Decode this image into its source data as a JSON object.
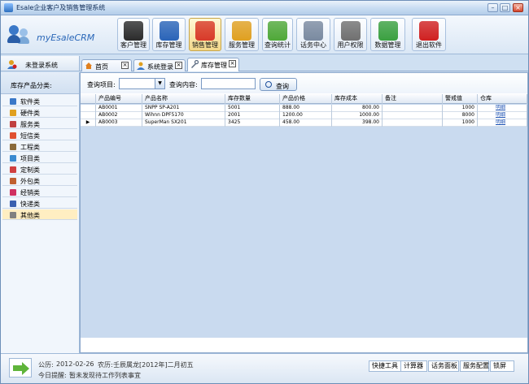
{
  "window": {
    "title": "Esale企业客户及销售管理系统"
  },
  "app": {
    "name": "myEsaleCRM"
  },
  "toolbar": [
    {
      "label": "客户管理",
      "icon": "customer-icon",
      "color": "#2b2b2b",
      "active": false
    },
    {
      "label": "库存管理",
      "icon": "book-icon",
      "color": "#2a64b8",
      "active": false
    },
    {
      "label": "销售管理",
      "icon": "sale-tag-icon",
      "color": "#d83a2a",
      "active": true
    },
    {
      "label": "服务管理",
      "icon": "gift-icon",
      "color": "#e0a020",
      "active": false
    },
    {
      "label": "查询统计",
      "icon": "money-icon",
      "color": "#4fa838",
      "active": false
    },
    {
      "label": "话务中心",
      "icon": "phone-icon",
      "color": "#7a8aa0",
      "active": false
    },
    {
      "label": "用户权限",
      "icon": "user-docs-icon",
      "color": "#707070",
      "active": false
    },
    {
      "label": "数据管理",
      "icon": "database-icon",
      "color": "#3aa040",
      "active": false
    },
    {
      "label": "退出软件",
      "icon": "power-icon",
      "color": "#d02020",
      "active": false
    }
  ],
  "nav": {
    "user_text": "未登录系统"
  },
  "tabs": [
    {
      "label": "首页",
      "icon": "home-icon"
    },
    {
      "label": "系统登录",
      "icon": "user-icon"
    },
    {
      "label": "库存管理",
      "icon": "tool-icon"
    }
  ],
  "sidebar": {
    "title": "库存产品分类:",
    "items": [
      {
        "label": "软件类",
        "color": "#3a78c8"
      },
      {
        "label": "硬件类",
        "color": "#e0a020"
      },
      {
        "label": "服务类",
        "color": "#c04040"
      },
      {
        "label": "短信类",
        "color": "#e05030"
      },
      {
        "label": "工程类",
        "color": "#8a6a3a"
      },
      {
        "label": "项目类",
        "color": "#3a8ad0"
      },
      {
        "label": "定制类",
        "color": "#d04040"
      },
      {
        "label": "外包类",
        "color": "#c06030"
      },
      {
        "label": "经销类",
        "color": "#d03060"
      },
      {
        "label": "快递类",
        "color": "#3a60b0"
      },
      {
        "label": "其他类",
        "color": "#808080"
      }
    ],
    "selected_index": 10
  },
  "query": {
    "field_label": "查询项目:",
    "content_label": "查询内容:",
    "search_label": "查询"
  },
  "table": {
    "columns": [
      "产品编号",
      "产品名称",
      "库存数量",
      "产品价格",
      "库存成本",
      "备注",
      "警戒值",
      "仓库"
    ],
    "rows": [
      {
        "id": "AB0001",
        "name": "SNPP SP-A201",
        "qty": "5001",
        "price": "888.00",
        "cost": "800.00",
        "note": "",
        "alert": "1000",
        "store": "明细"
      },
      {
        "id": "AB0002",
        "name": "Wihnn DPF5170",
        "qty": "2001",
        "price": "1200.00",
        "cost": "1000.00",
        "note": "",
        "alert": "8000",
        "store": "明细"
      },
      {
        "id": "AB0003",
        "name": "SuperMan SX201",
        "qty": "3425",
        "price": "458.00",
        "cost": "398.00",
        "note": "",
        "alert": "1000",
        "store": "明细"
      }
    ],
    "current_row": 2
  },
  "status": {
    "date_label": "公历:",
    "date": "2012-02-26",
    "lunar_label": "农历:",
    "lunar": "壬辰属龙[2012年]二月初五",
    "reminder_label": "今日提醒:",
    "reminder": "暂未发现待工作列表事宜",
    "quick_tools": "快捷工具",
    "tools": [
      "计算器",
      "话务面板",
      "服务配置",
      "锁屏"
    ]
  }
}
